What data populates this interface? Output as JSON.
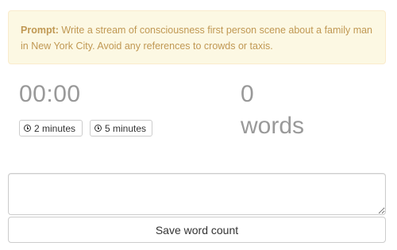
{
  "prompt": {
    "lead": "Prompt:",
    "text": "Write a stream of consciousness first person scene about a family man in New York City. Avoid any references to crowds or taxis."
  },
  "timer": {
    "display": "00:00",
    "buttons": [
      {
        "label": "2 minutes",
        "icon": "clock-icon"
      },
      {
        "label": "5 minutes",
        "icon": "clock-icon"
      }
    ]
  },
  "word_counter": {
    "count": "0",
    "unit": "words"
  },
  "editor": {
    "value": ""
  },
  "save": {
    "label": "Save word count"
  },
  "colors": {
    "alert_bg": "#fcf8e3",
    "alert_border": "#faebcc",
    "alert_text": "#c09853",
    "muted_text": "#999999"
  }
}
